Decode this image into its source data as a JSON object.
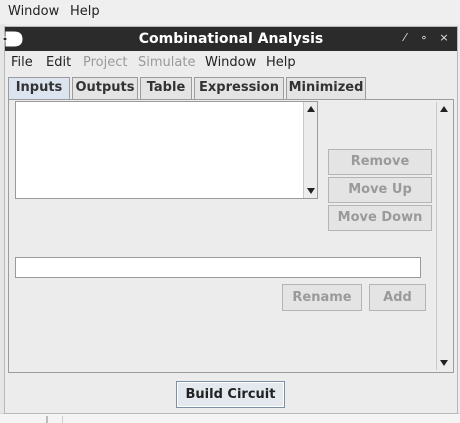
{
  "host_menubar": {
    "items": [
      "Window",
      "Help"
    ]
  },
  "window": {
    "title": "Combinational Analysis",
    "controls": {
      "minimize": "⁄",
      "maximize": "∘",
      "close": "×"
    }
  },
  "menubar": {
    "items": [
      {
        "label": "File",
        "enabled": true
      },
      {
        "label": "Edit",
        "enabled": true
      },
      {
        "label": "Project",
        "enabled": false
      },
      {
        "label": "Simulate",
        "enabled": false
      },
      {
        "label": "Window",
        "enabled": true
      },
      {
        "label": "Help",
        "enabled": true
      }
    ]
  },
  "tabs": [
    {
      "label": "Inputs",
      "active": true
    },
    {
      "label": "Outputs",
      "active": false
    },
    {
      "label": "Table",
      "active": false
    },
    {
      "label": "Expression",
      "active": false
    },
    {
      "label": "Minimized",
      "active": false
    }
  ],
  "inputs_panel": {
    "variables": [],
    "name_field": {
      "value": ""
    },
    "buttons": {
      "remove": "Remove",
      "move_up": "Move Up",
      "move_down": "Move Down",
      "rename": "Rename",
      "add": "Add"
    }
  },
  "footer": {
    "build_circuit": "Build Circuit"
  },
  "colors": {
    "titlebar": "#2b2b2b",
    "active_tab": "#dbe4ef",
    "disabled_text": "#9a9a9a"
  },
  "icons": [
    "logisim-gate-icon",
    "minimize-icon",
    "maximize-icon",
    "close-icon",
    "scroll-up-icon",
    "scroll-down-icon"
  ]
}
